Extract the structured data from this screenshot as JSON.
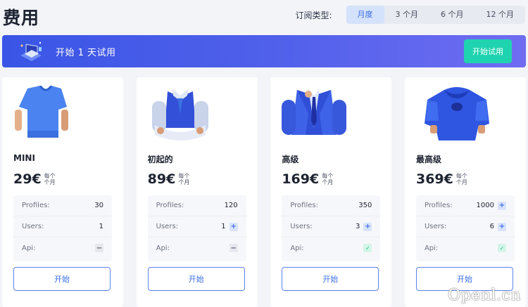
{
  "page_title": "费用",
  "period": {
    "label": "订阅类型:",
    "tabs": [
      "月度",
      "3 个月",
      "6 个月",
      "12 个月"
    ],
    "active": 0
  },
  "trial": {
    "text": "开始 1 天试用",
    "button": "开始试用"
  },
  "plans": [
    {
      "name": "MINI",
      "price": "29€",
      "unit_line1": "每个",
      "unit_line2": "个月",
      "features": [
        {
          "label": "Profiles:",
          "value": "30",
          "icon": ""
        },
        {
          "label": "Users:",
          "value": "1",
          "icon": ""
        },
        {
          "label": "Api:",
          "value": "",
          "icon": "minus-icon"
        }
      ],
      "button": "开始"
    },
    {
      "name": "初起的",
      "price": "89€",
      "unit_line1": "每个",
      "unit_line2": "个月",
      "features": [
        {
          "label": "Profiles:",
          "value": "120",
          "icon": ""
        },
        {
          "label": "Users:",
          "value": "1",
          "icon": "plus-icon"
        },
        {
          "label": "Api:",
          "value": "",
          "icon": "minus-icon"
        }
      ],
      "button": "开始"
    },
    {
      "name": "高级",
      "price": "169€",
      "unit_line1": "每个",
      "unit_line2": "个月",
      "features": [
        {
          "label": "Profiles:",
          "value": "350",
          "icon": ""
        },
        {
          "label": "Users:",
          "value": "3",
          "icon": "plus-icon"
        },
        {
          "label": "Api:",
          "value": "",
          "icon": "check-icon"
        }
      ],
      "button": "开始"
    },
    {
      "name": "最高级",
      "price": "369€",
      "unit_line1": "每个",
      "unit_line2": "个月",
      "features": [
        {
          "label": "Profiles:",
          "value": "1000",
          "icon": "plus-icon"
        },
        {
          "label": "Users:",
          "value": "6",
          "icon": "plus-icon"
        },
        {
          "label": "Api:",
          "value": "",
          "icon": "check-icon"
        }
      ],
      "button": "开始"
    }
  ],
  "watermark": "Openl.cn",
  "colors": {
    "accent": "#3b6ee6",
    "banner": "#4a5ae8",
    "trial_button": "#1fd3b0"
  }
}
